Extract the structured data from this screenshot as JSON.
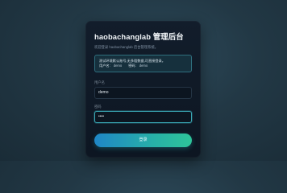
{
  "login": {
    "title": "haobachanglab 管理后台",
    "subtitle": "欢迎登录 haobachanglab 后台管理系统。",
    "hint": {
      "line1": "测试环境默认账号,无多租数据,可直接登录。",
      "username_label": "用户名:",
      "username_value": "demo",
      "password_label": "密码:",
      "password_value": "demo"
    },
    "username": {
      "label": "用户名",
      "value": "demo"
    },
    "password": {
      "label": "密码",
      "value": "••••"
    },
    "submit_label": "登录"
  },
  "colors": {
    "accent_start": "#1f86c6",
    "accent_end": "#2ec49a",
    "hint_border": "#2f6f7e"
  }
}
